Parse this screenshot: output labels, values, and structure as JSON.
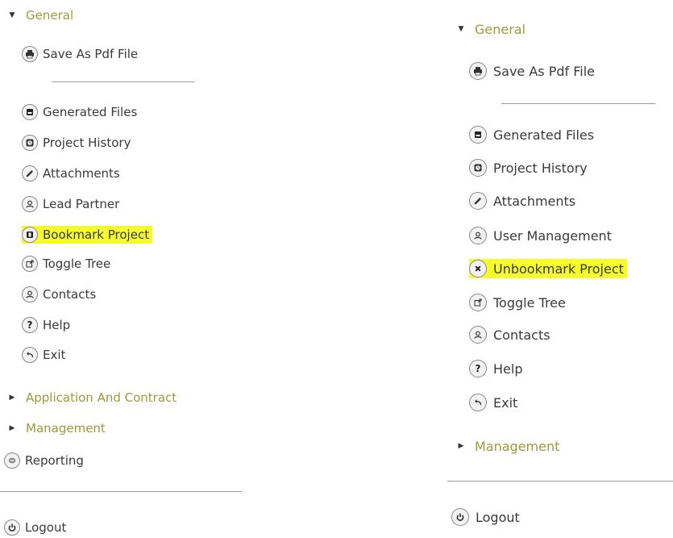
{
  "left": {
    "general_header": "General",
    "save_pdf": "Save As Pdf File",
    "items": [
      {
        "label": "Generated Files",
        "icon": "file-icon"
      },
      {
        "label": "Project History",
        "icon": "history-icon"
      },
      {
        "label": "Attachments",
        "icon": "paperclip-icon"
      },
      {
        "label": "Lead Partner",
        "icon": "user-icon"
      },
      {
        "label": "Bookmark Project",
        "icon": "bookmark-icon",
        "highlighted": true
      },
      {
        "label": "Toggle Tree",
        "icon": "external-link-icon"
      },
      {
        "label": "Contacts",
        "icon": "user-icon"
      },
      {
        "label": "Help",
        "icon": "help-icon"
      },
      {
        "label": "Exit",
        "icon": "undo-icon"
      }
    ],
    "sections": [
      "Application And Contract",
      "Management"
    ],
    "reporting": "Reporting",
    "logout": "Logout"
  },
  "right": {
    "general_header": "General",
    "save_pdf": "Save As Pdf File",
    "items": [
      {
        "label": "Generated Files",
        "icon": "file-icon"
      },
      {
        "label": "Project History",
        "icon": "history-icon"
      },
      {
        "label": "Attachments",
        "icon": "paperclip-icon"
      },
      {
        "label": "User Management",
        "icon": "user-icon"
      },
      {
        "label": "Unbookmark Project",
        "icon": "close-icon",
        "highlighted": true
      },
      {
        "label": "Toggle Tree",
        "icon": "external-link-icon"
      },
      {
        "label": "Contacts",
        "icon": "user-icon"
      },
      {
        "label": "Help",
        "icon": "help-icon"
      },
      {
        "label": "Exit",
        "icon": "undo-icon"
      }
    ],
    "sections": [
      "Management"
    ],
    "logout": "Logout"
  },
  "colors": {
    "section_header": "#9b9b3a",
    "highlight": "#f6fb2a",
    "text": "#3a3a3a"
  }
}
